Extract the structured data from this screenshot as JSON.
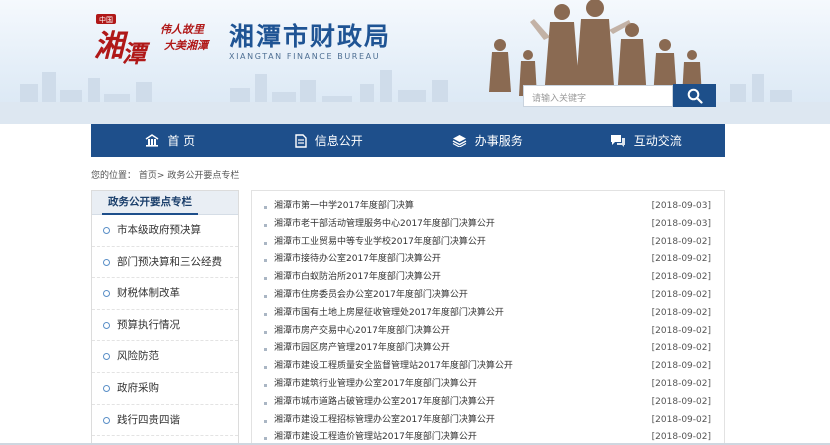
{
  "header": {
    "slogan_line1": "伟人故里",
    "slogan_line2": "大美湘潭",
    "site_title": "湘潭市财政局",
    "site_subtitle": "XIANGTAN FINANCE BUREAU",
    "logo_small": "中国",
    "logo_text": "湘潭",
    "search_placeholder": "请输入关键字"
  },
  "nav": {
    "items": [
      {
        "label": "首 页",
        "icon": "home-icon"
      },
      {
        "label": "信息公开",
        "icon": "document-icon"
      },
      {
        "label": "办事服务",
        "icon": "layers-icon"
      },
      {
        "label": "互动交流",
        "icon": "chat-icon"
      }
    ]
  },
  "breadcrumb": {
    "prefix": "您的位置：",
    "home": "首页",
    "separator": ">",
    "current": "政务公开要点专栏"
  },
  "sidebar": {
    "title": "政务公开要点专栏",
    "items": [
      "市本级政府预决算",
      "部门预决算和三公经费",
      "财税体制改革",
      "预算执行情况",
      "风险防范",
      "政府采购",
      "践行四贵四谐"
    ]
  },
  "articles": [
    {
      "title": "湘潭市第一中学2017年度部门决算",
      "date": "[2018-09-03]"
    },
    {
      "title": "湘潭市老干部活动管理服务中心2017年度部门决算公开",
      "date": "[2018-09-03]"
    },
    {
      "title": "湘潭市工业贸易中等专业学校2017年度部门决算公开",
      "date": "[2018-09-02]"
    },
    {
      "title": "湘潭市接待办公室2017年度部门决算公开",
      "date": "[2018-09-02]"
    },
    {
      "title": "湘潭市白蚁防治所2017年度部门决算公开",
      "date": "[2018-09-02]"
    },
    {
      "title": "湘潭市住房委员会办公室2017年度部门决算公开",
      "date": "[2018-09-02]"
    },
    {
      "title": "湘潭市国有土地上房屋征收管理处2017年度部门决算公开",
      "date": "[2018-09-02]"
    },
    {
      "title": "湘潭市房产交易中心2017年度部门决算公开",
      "date": "[2018-09-02]"
    },
    {
      "title": "湘潭市园区房产管理2017年度部门决算公开",
      "date": "[2018-09-02]"
    },
    {
      "title": "湘潭市建设工程质量安全监督管理站2017年度部门决算公开",
      "date": "[2018-09-02]"
    },
    {
      "title": "湘潭市建筑行业管理办公室2017年度部门决算公开",
      "date": "[2018-09-02]"
    },
    {
      "title": "湘潭市城市道路占破管理办公室2017年度部门决算公开",
      "date": "[2018-09-02]"
    },
    {
      "title": "湘潭市建设工程招标管理办公室2017年度部门决算公开",
      "date": "[2018-09-02]"
    },
    {
      "title": "湘潭市建设工程造价管理站2017年度部门决算公开",
      "date": "[2018-09-02]"
    }
  ],
  "colors": {
    "nav_bg": "#1e4f8b",
    "title_blue": "#1f5494",
    "logo_red": "#b01818"
  }
}
